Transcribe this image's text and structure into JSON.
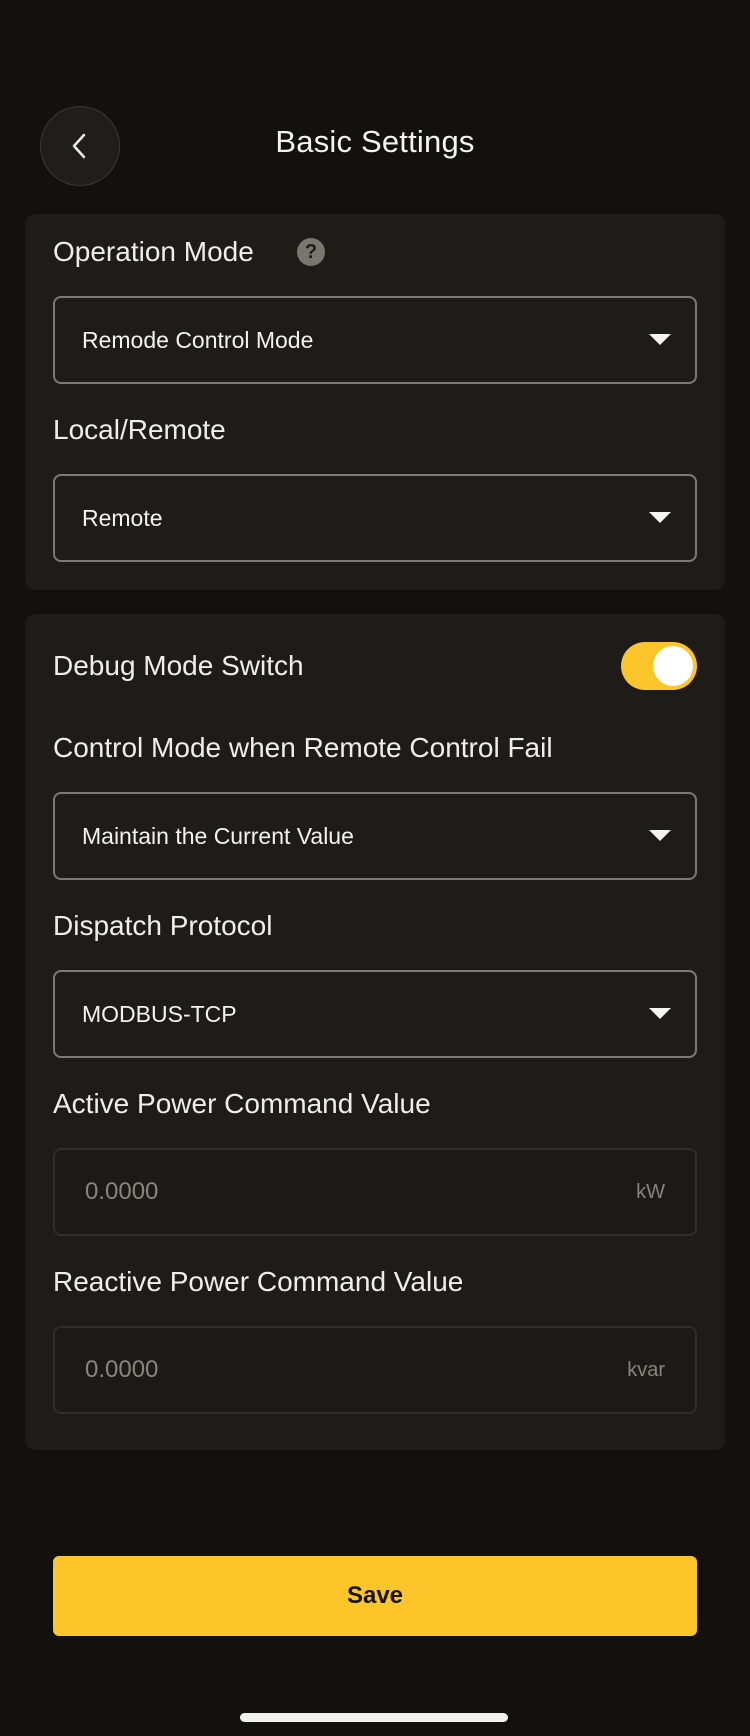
{
  "header": {
    "title": "Basic Settings",
    "back_icon": "chevron-left-icon"
  },
  "card1": {
    "operation_mode_label": "Operation Mode",
    "help_icon_glyph": "?",
    "operation_mode_value": "Remode Control Mode",
    "local_remote_label": "Local/Remote",
    "local_remote_value": "Remote"
  },
  "card2": {
    "debug_label": "Debug Mode Switch",
    "debug_on": true,
    "fail_mode_label": "Control Mode when Remote Control Fail",
    "fail_mode_value": "Maintain the Current Value",
    "protocol_label": "Dispatch Protocol",
    "protocol_value": "MODBUS-TCP",
    "active_power_label": "Active Power Command Value",
    "active_power_placeholder": "0.0000",
    "active_power_unit": "kW",
    "reactive_power_label": "Reactive Power Command Value",
    "reactive_power_placeholder": "0.0000",
    "reactive_power_unit": "kvar"
  },
  "footer": {
    "save_label": "Save"
  },
  "colors": {
    "background": "#12110d",
    "card": "#1d1c19",
    "accent": "#fcc62a"
  }
}
